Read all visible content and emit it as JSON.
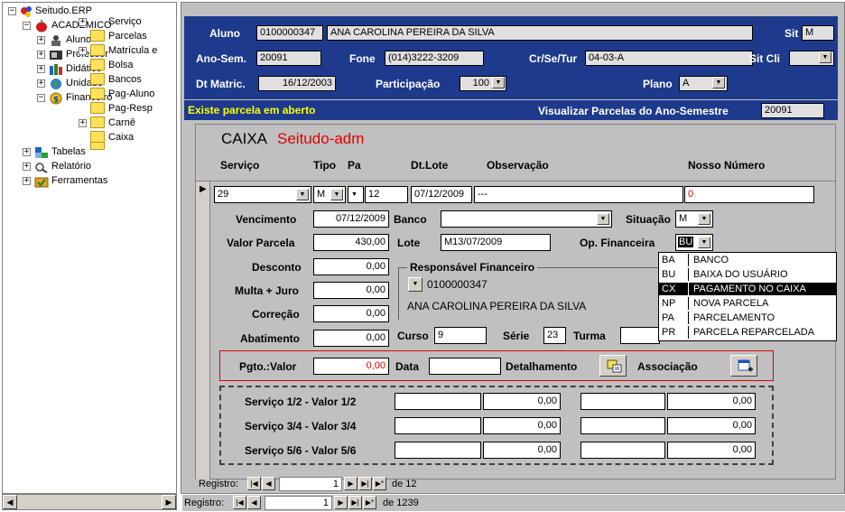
{
  "tree": {
    "root": "Seitudo.ERP",
    "items": [
      {
        "label": "ACADÊMICO"
      },
      {
        "label": "Aluno"
      },
      {
        "label": "Professor"
      },
      {
        "label": "Didático"
      },
      {
        "label": "Unidade"
      },
      {
        "label": "Financeiro"
      },
      {
        "label": "Serviço"
      },
      {
        "label": "Parcelas"
      },
      {
        "label": "Matrícula e"
      },
      {
        "label": "Bolsa"
      },
      {
        "label": "Bancos"
      },
      {
        "label": "Pag-Aluno"
      },
      {
        "label": "Pag-Resp"
      },
      {
        "label": "Carnê"
      },
      {
        "label": "Caixa"
      },
      {
        "label": "Tabelas"
      },
      {
        "label": "Relatório"
      },
      {
        "label": "Ferramentas"
      }
    ]
  },
  "header": {
    "aluno_label": "Aluno",
    "aluno_code": "0100000347",
    "aluno_name": "ANA CAROLINA PEREIRA DA SILVA",
    "sit_label": "Sit",
    "sit_value": "M",
    "anosem_label": "Ano-Sem.",
    "anosem_value": "20091",
    "fone_label": "Fone",
    "fone_value": "(014)3222-3209",
    "crsetur_label": "Cr/Se/Tur",
    "crsetur_value": "04-03-A",
    "sitcli_label": "Sit Cli",
    "sitcli_value": "",
    "dtmatric_label": "Dt Matric.",
    "dtmatric_value": "16/12/2003",
    "participacao_label": "Participação",
    "participacao_value": "100",
    "plano_label": "Plano",
    "plano_value": "A"
  },
  "msg": {
    "warning": "Existe parcela em aberto",
    "visualizar_label": "Visualizar Parcelas do Ano-Semestre",
    "visualizar_value": "20091"
  },
  "sub": {
    "title_black": "CAIXA",
    "title_red": "Seitudo-adm",
    "cols": {
      "servico": "Serviço",
      "tipo": "Tipo",
      "pa": "Pa",
      "dtlote": "Dt.Lote",
      "obs": "Observação",
      "nosso": "Nosso Número"
    },
    "row": {
      "servico": "29",
      "tipo": "M",
      "pa": "12",
      "dtlote": "07/12/2009",
      "obs": "---",
      "nosso": "0"
    },
    "vencimento_label": "Vencimento",
    "vencimento_value": "07/12/2009",
    "banco_label": "Banco",
    "banco_value": "",
    "situacao_label": "Situação",
    "situacao_value": "M",
    "valorparcela_label": "Valor Parcela",
    "valorparcela_value": "430,00",
    "lote_label": "Lote",
    "lote_value": "M13/07/2009",
    "opfin_label": "Op. Financeira",
    "opfin_value": "BU",
    "desconto_label": "Desconto",
    "desconto_value": "0,00",
    "multa_label": "Multa + Juro",
    "multa_value": "0,00",
    "correcao_label": "Correção",
    "correcao_value": "0,00",
    "abatimento_label": "Abatimento",
    "abatimento_value": "0,00",
    "resp_title": "Responsável Financeiro",
    "resp_code": "0100000347",
    "resp_name": "ANA CAROLINA PEREIRA DA SILVA",
    "curso_label": "Curso",
    "curso_value": "9",
    "serie_label": "Série",
    "serie_value": "23",
    "turma_label": "Turma",
    "turma_value": "",
    "pgto_label": "Pgto.:Valor",
    "pgto_value": "0,00",
    "data_label": "Data",
    "data_value": "",
    "detalhamento_label": "Detalhamento",
    "associacao_label": "Associação",
    "servicos": [
      {
        "label": "Serviço 1/2 - Valor 1/2",
        "v1": "",
        "v2": "0,00",
        "v3": "",
        "v4": "0,00"
      },
      {
        "label": "Serviço 3/4 - Valor 3/4",
        "v1": "",
        "v2": "0,00",
        "v3": "",
        "v4": "0,00"
      },
      {
        "label": "Serviço 5/6 - Valor 5/6",
        "v1": "",
        "v2": "0,00",
        "v3": "",
        "v4": "0,00"
      }
    ],
    "nav": {
      "label": "Registro:",
      "value": "1",
      "of": "de 12"
    }
  },
  "dropdown": [
    {
      "code": "BA",
      "name": "BANCO",
      "selected": false
    },
    {
      "code": "BU",
      "name": "BAIXA DO USUÁRIO",
      "selected": false
    },
    {
      "code": "CX",
      "name": "PAGAMENTO NO CAIXA",
      "selected": true
    },
    {
      "code": "NP",
      "name": "NOVA PARCELA",
      "selected": false
    },
    {
      "code": "PA",
      "name": "PARCELAMENTO",
      "selected": false
    },
    {
      "code": "PR",
      "name": "PARCELA REPARCELADA",
      "selected": false
    }
  ],
  "mainnav": {
    "label": "Registro:",
    "value": "1",
    "of": "de 1239"
  },
  "colors": {
    "header_bg": "#1e3a8c",
    "warning": "#ffff00",
    "red": "#e00000",
    "form_bg": "#c0c0c0"
  }
}
